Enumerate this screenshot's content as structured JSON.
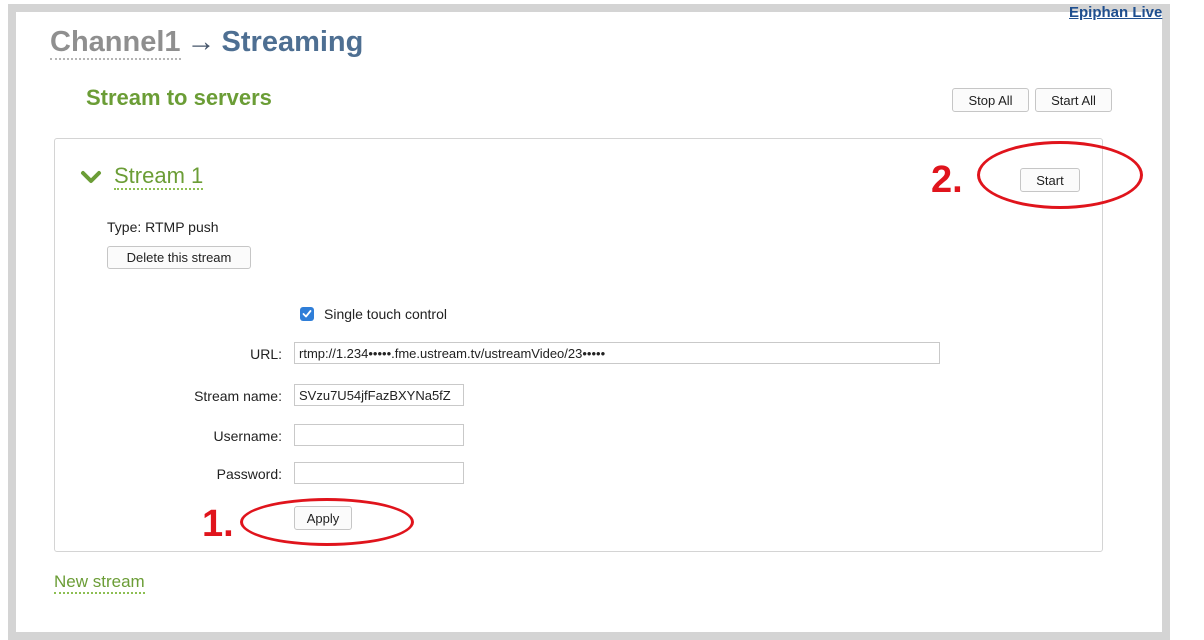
{
  "header": {
    "top_link": "Epiphan Live",
    "breadcrumb_channel": "Channel1",
    "breadcrumb_arrow": "→",
    "breadcrumb_current": "Streaming"
  },
  "section": {
    "title": "Stream to servers",
    "stop_all_label": "Stop All",
    "start_all_label": "Start All"
  },
  "stream": {
    "title": "Stream 1",
    "start_label": "Start",
    "type_text": "Type: RTMP push",
    "delete_label": "Delete this stream",
    "single_touch_label": "Single touch control",
    "single_touch_checked": true,
    "url_label": "URL:",
    "url_value": "rtmp://1.234•••••.fme.ustream.tv/ustreamVideo/23•••••",
    "stream_name_label": "Stream name:",
    "stream_name_value": "SVzu7U54jfFazBXYNa5fZ",
    "username_label": "Username:",
    "username_value": "",
    "password_label": "Password:",
    "password_value": "",
    "apply_label": "Apply"
  },
  "footer": {
    "new_stream_label": "New stream"
  },
  "annotations": {
    "step_1": "1.",
    "step_2": "2."
  },
  "icons": {
    "chevron": "chevron-down-icon",
    "checkbox": "checkmark-icon"
  },
  "colors": {
    "accent_green": "#6b9d36",
    "title_blue": "#4e6f92",
    "annotation_red": "#e0141c",
    "checkbox_blue": "#2f7ed8"
  }
}
